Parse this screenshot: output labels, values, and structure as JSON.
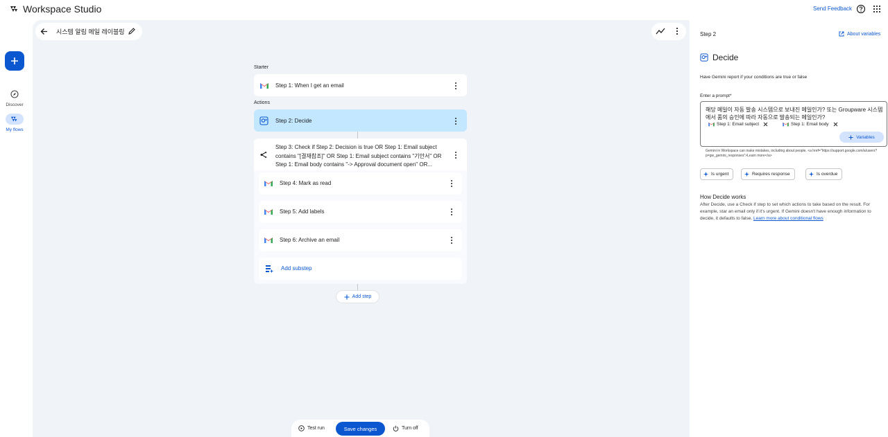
{
  "app": {
    "title": "Workspace Studio",
    "send_feedback": "Send Feedback"
  },
  "rail": {
    "create_label": "+",
    "items": [
      {
        "label": "Discover",
        "icon": "compass-icon"
      },
      {
        "label": "My flows",
        "icon": "flows-icon",
        "active": true
      }
    ]
  },
  "flow": {
    "title": "시스템 알림 메일 레이블링"
  },
  "builder": {
    "starter_label": "Starter",
    "actions_label": "Actions",
    "steps": [
      {
        "prefix": "Step 1:",
        "text": "When I get an email",
        "icon": "gmail-icon"
      },
      {
        "prefix": "Step 2:",
        "text": "Decide",
        "icon": "gemini-decide-icon",
        "selected": true
      },
      {
        "prefix": "Step 3:",
        "text": "Check if Step 2: Decision is true OR Step 1: Email subject contains \"[결재참조]\" OR Step 1: Email subject contains \"기안서\" OR Step 1: Email body contains \"-> Approval document open\" OR...",
        "icon": "branch-icon"
      }
    ],
    "substeps": [
      {
        "prefix": "Step 4:",
        "text": "Mark as read",
        "icon": "gmail-icon"
      },
      {
        "prefix": "Step 5:",
        "text": "Add labels",
        "icon": "gmail-icon"
      },
      {
        "prefix": "Step 6:",
        "text": "Archive an email",
        "icon": "gmail-icon"
      }
    ],
    "add_substep": "Add substep",
    "add_step": "Add step"
  },
  "bottom": {
    "test_run": "Test run",
    "save": "Save changes",
    "turn_off": "Turn off"
  },
  "panel": {
    "step_label": "Step 2",
    "about_variables": "About variables",
    "title": "Decide",
    "description": "Have Gemini report if your conditions are true or false",
    "prompt_label": "Enter a prompt*",
    "prompt_text": "해당 메일이 자동 발송 시스템으로 보내진 메일인가? 또는 Groupware 시스템에서 품의 승인에 따라 자동으로 발송되는 메일인가?",
    "chips": [
      "Step 1: Email subject",
      "Step 1: Email body"
    ],
    "variables_button": "Variables",
    "disclaimer": "Gemini in Workspace can make mistakes, including about people. <a href=\"https://support.google.com/a/users?p=gw_gemini_responses\">Learn more</a>",
    "suggestions": [
      "Is urgent",
      "Requires response",
      "Is overdue"
    ],
    "how_title": "How Decide works",
    "how_text": "After Decide, use a Check if step to set which actions to take based on the result. For example, star an email only if it's urgent. If Gemini doesn't have enough information to decide, it defaults to false.",
    "how_link": "Learn more about conditional flows"
  },
  "colors": {
    "accent": "#0b57d0",
    "selected": "#c2e7ff",
    "canvas": "#f0f4f9"
  }
}
